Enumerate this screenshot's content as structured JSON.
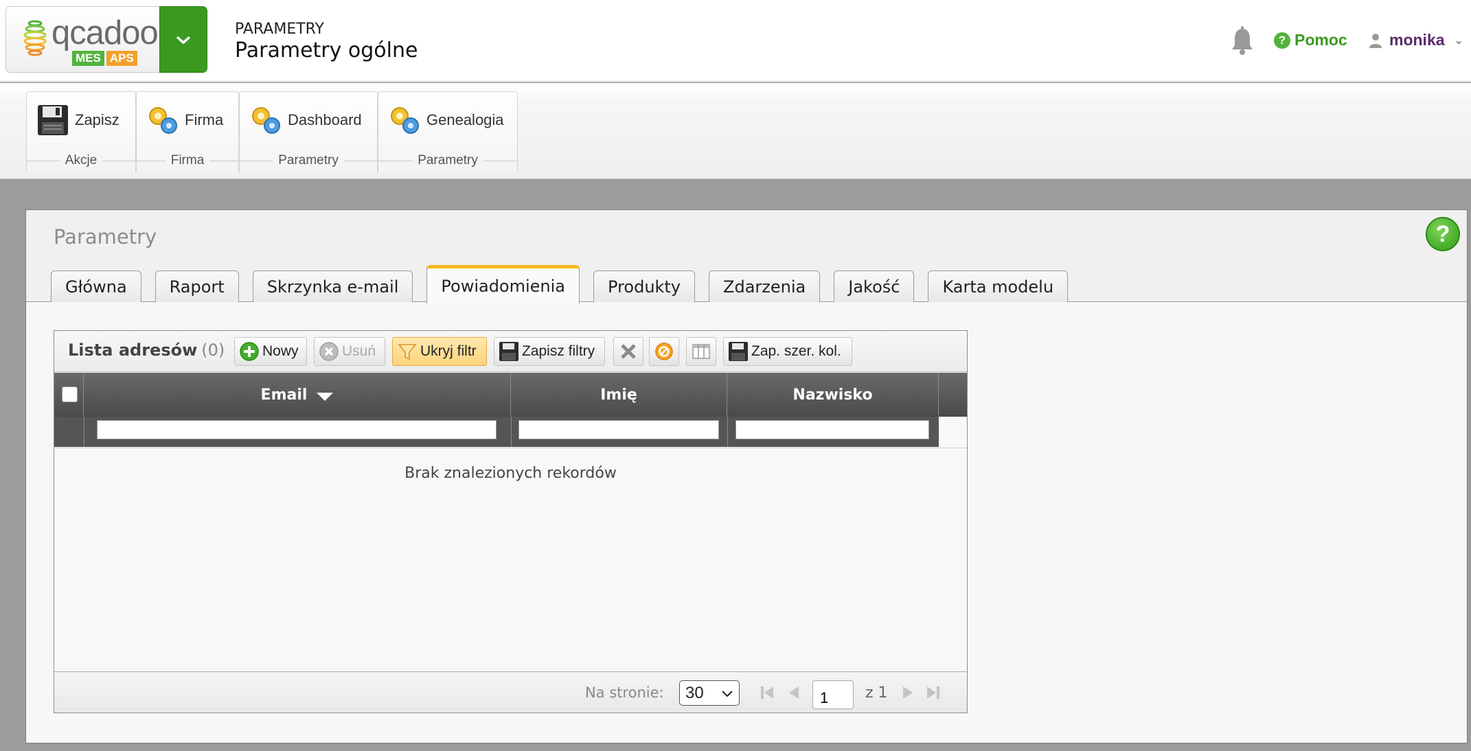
{
  "app": {
    "logo_text": "qcadoo",
    "logo_tags": [
      "MES",
      "APS"
    ],
    "section": "PARAMETRY",
    "title": "Parametry ogólne"
  },
  "header_right": {
    "help_label": "Pomoc",
    "help_icon": "question-icon",
    "user_name": "monika",
    "bell_icon": "bell-icon"
  },
  "ribbon": {
    "groups": [
      {
        "button_label": "Zapisz",
        "icon": "floppy-icon",
        "group_label": "Akcje"
      },
      {
        "button_label": "Firma",
        "icon": "gears-icon",
        "group_label": "Firma"
      },
      {
        "button_label": "Dashboard",
        "icon": "gears-icon",
        "group_label": "Parametry"
      },
      {
        "button_label": "Genealogia",
        "icon": "gears-icon",
        "group_label": "Parametry"
      }
    ]
  },
  "panel": {
    "title": "Parametry",
    "help_glyph": "?",
    "tabs": [
      "Główna",
      "Raport",
      "Skrzynka e-mail",
      "Powiadomienia",
      "Produkty",
      "Zdarzenia",
      "Jakość",
      "Karta modelu"
    ],
    "active_tab": "Powiadomienia"
  },
  "grid": {
    "caption": "Lista adresów",
    "count": "(0)",
    "toolbar": {
      "new_label": "Nowy",
      "delete_label": "Usuń",
      "hide_filter_label": "Ukryj filtr",
      "save_filters_label": "Zapisz filtry",
      "save_col_width_label": "Zap. szer. kol."
    },
    "columns": [
      "Email",
      "Imię",
      "Nazwisko"
    ],
    "sorted_column": "Email",
    "sort_direction": "desc",
    "filters": [
      "",
      "",
      ""
    ],
    "empty_message": "Brak znalezionych rekordów",
    "footer": {
      "per_page_label": "Na stronie:",
      "per_page_value": "30",
      "page_value": "1",
      "page_of": "z 1"
    }
  },
  "colors": {
    "brand_green": "#3a9a1f",
    "active_tab_accent": "#f5b820",
    "header_dark": "#4a4a4a"
  }
}
